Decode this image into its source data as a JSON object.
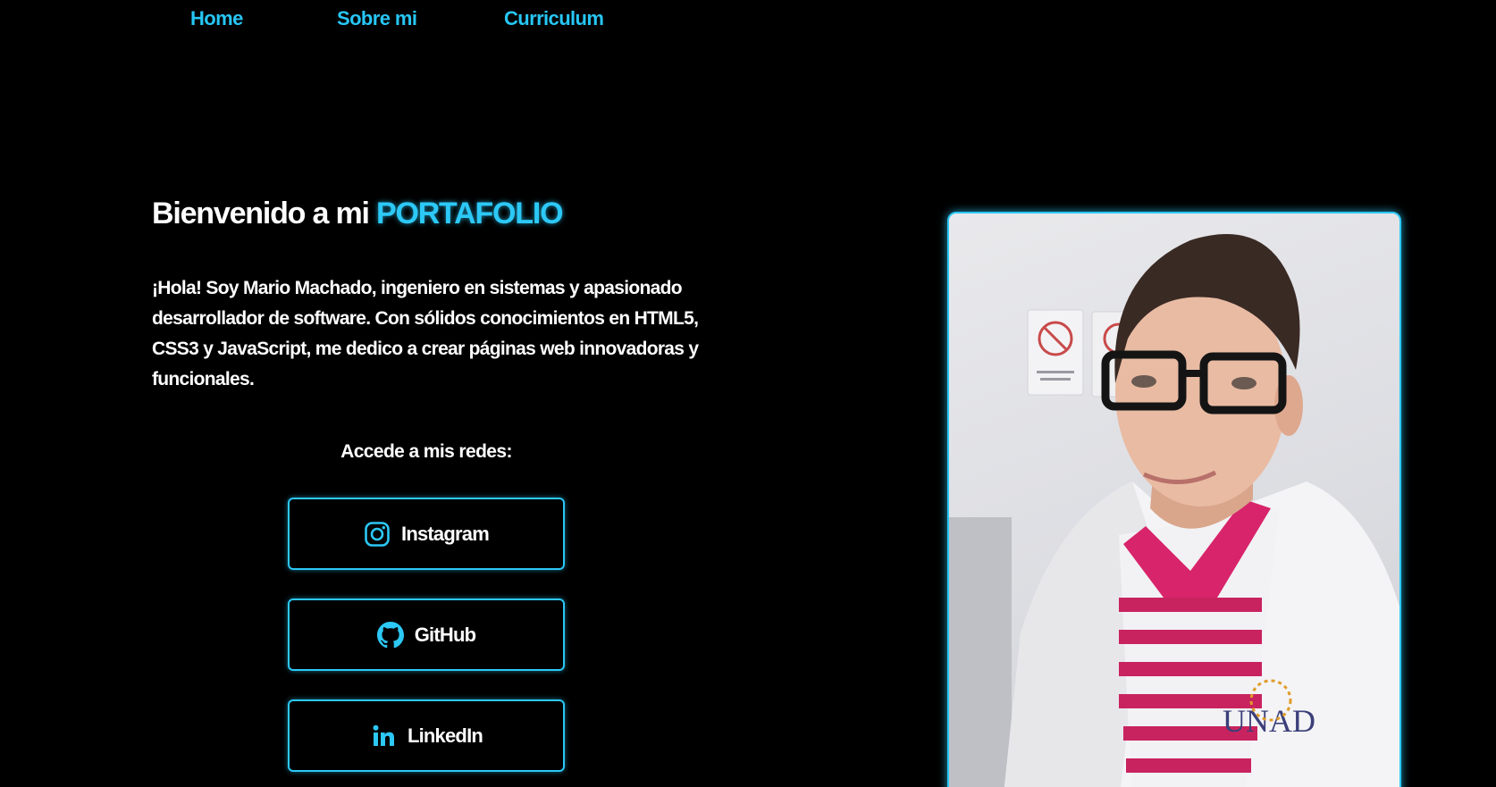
{
  "nav": {
    "items": [
      "Home",
      "Sobre mi",
      "Curriculum"
    ]
  },
  "hero": {
    "title_prefix": "Bienvenido a mi",
    "title_highlight": "PORTAFOLIO",
    "intro": "¡Hola! Soy Mario Machado, ingeniero en sistemas y apasionado desarrollador de software. Con sólidos conocimientos en HTML5, CSS3 y JavaScript, me dedico a crear páginas web innovadoras y funcionales."
  },
  "social": {
    "heading": "Accede a mis redes:",
    "links": [
      {
        "label": "Instagram",
        "icon": "instagram-icon"
      },
      {
        "label": "GitHub",
        "icon": "github-icon"
      },
      {
        "label": "LinkedIn",
        "icon": "linkedin-icon"
      }
    ]
  },
  "photo": {
    "badge_text": "UNAD"
  },
  "colors": {
    "background": "#000000",
    "accent": "#2cc8f6",
    "text": "#ffffff"
  }
}
